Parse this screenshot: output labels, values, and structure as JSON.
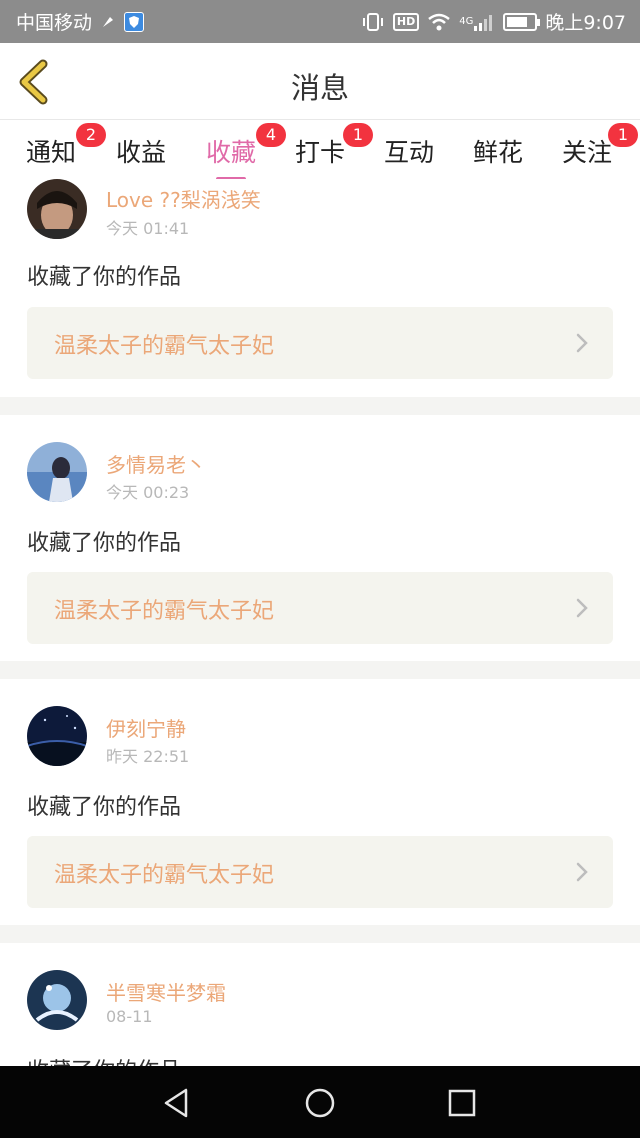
{
  "status_bar": {
    "carrier": "中国移动",
    "network": "4G",
    "hd": "HD",
    "time": "晚上9:07",
    "battery_level": 0.75
  },
  "header": {
    "title": "消息",
    "back_icon": "chevron-left-icon"
  },
  "tabs": [
    {
      "label": "通知",
      "badge": "2"
    },
    {
      "label": "收益",
      "badge": ""
    },
    {
      "label": "收藏",
      "badge": "4",
      "active": true
    },
    {
      "label": "打卡",
      "badge": "1"
    },
    {
      "label": "互动",
      "badge": ""
    },
    {
      "label": "鲜花",
      "badge": ""
    },
    {
      "label": "关注",
      "badge": "1"
    }
  ],
  "items": [
    {
      "name": "Love ??梨涡浅笑",
      "time": "今天 01:41",
      "action": "收藏了你的作品",
      "work": "温柔太子的霸气太子妃"
    },
    {
      "name": "多情易老丶",
      "time": "今天 00:23",
      "action": "收藏了你的作品",
      "work": "温柔太子的霸气太子妃"
    },
    {
      "name": "伊刻宁静",
      "time": "昨天 22:51",
      "action": "收藏了你的作品",
      "work": "温柔太子的霸气太子妃"
    },
    {
      "name": "半雪寒半梦霜",
      "time": "08-11",
      "action": "收藏了你的作品",
      "work": ""
    }
  ],
  "colors": {
    "accent": "#e06aa8",
    "name_color": "#eba778",
    "badge": "#f2333f",
    "status_bar": "#8c8c8c"
  },
  "nav_bar": {
    "back": "triangle-back-icon",
    "home": "circle-home-icon",
    "recent": "square-recent-icon"
  }
}
